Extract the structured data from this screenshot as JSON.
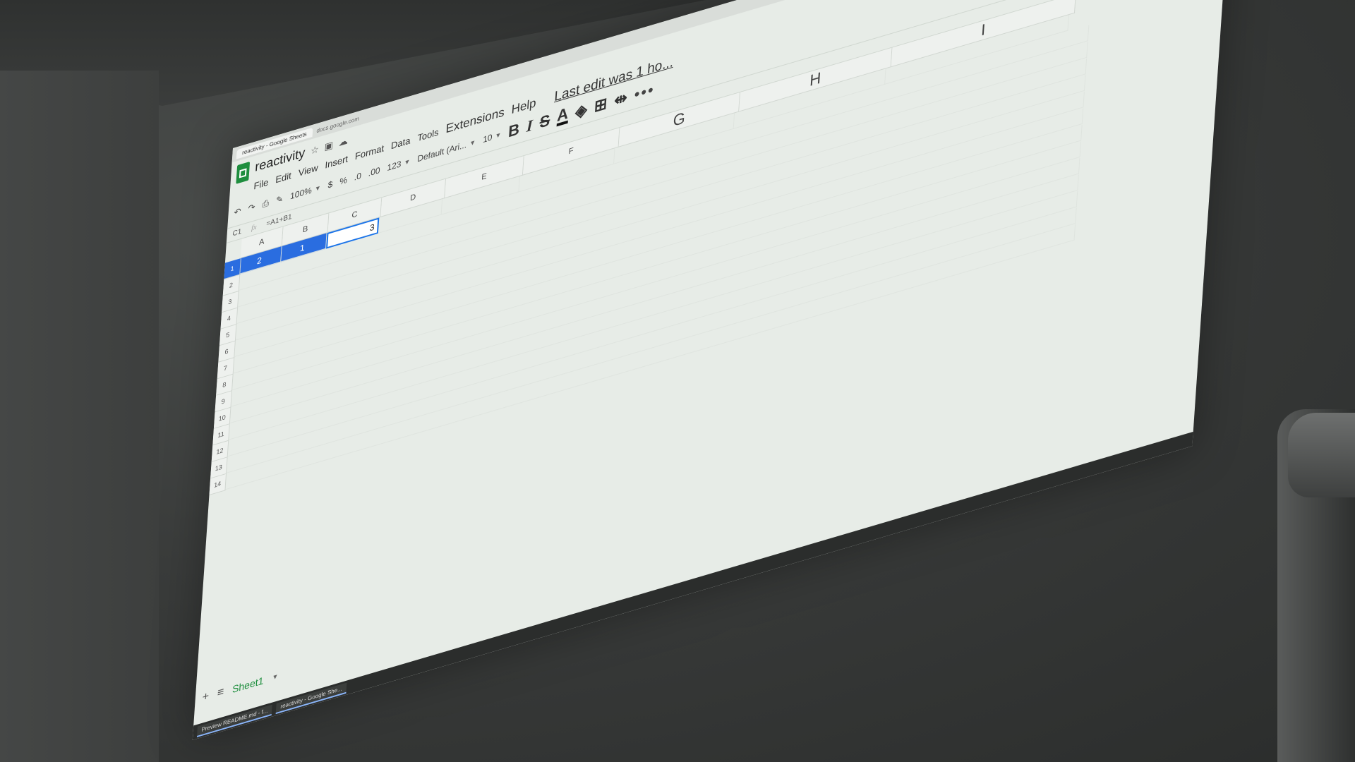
{
  "browser": {
    "tab_title": "reactivity - Google Sheets",
    "url": "docs.google.com"
  },
  "header": {
    "doc_title": "reactivity",
    "last_edit": "Last edit was 1 ho...",
    "menu": [
      "File",
      "Edit",
      "View",
      "Insert",
      "Format",
      "Data",
      "Tools",
      "Extensions",
      "Help"
    ]
  },
  "toolbar": {
    "zoom": "100%",
    "currency": "$",
    "percent": "%",
    "decrease_decimal": ".0",
    "increase_decimal": ".00",
    "format_more": "123",
    "font": "Default (Ari...",
    "font_size": "10",
    "bold": "B",
    "italic": "I",
    "strike": "S",
    "text_color": "A",
    "more": "•••"
  },
  "formula": {
    "name_box": "C1",
    "fx": "fx",
    "value": "=A1+B1"
  },
  "grid": {
    "columns": [
      "A",
      "B",
      "C",
      "D",
      "E",
      "F",
      "G",
      "H",
      "I"
    ],
    "rows": [
      "1",
      "2",
      "3",
      "4",
      "5",
      "6",
      "7",
      "8",
      "9",
      "10",
      "11",
      "12",
      "13",
      "14"
    ],
    "row1": {
      "A": "2",
      "B": "1",
      "C": "3"
    }
  },
  "sheets": {
    "add": "+",
    "list": "≡",
    "active": "Sheet1"
  },
  "taskbar": {
    "item1": "Preview README.md - f...",
    "item2": "reactivity - Google She..."
  },
  "colors": {
    "selection": "#2a6de0",
    "sheets_green": "#1e8e3e"
  }
}
